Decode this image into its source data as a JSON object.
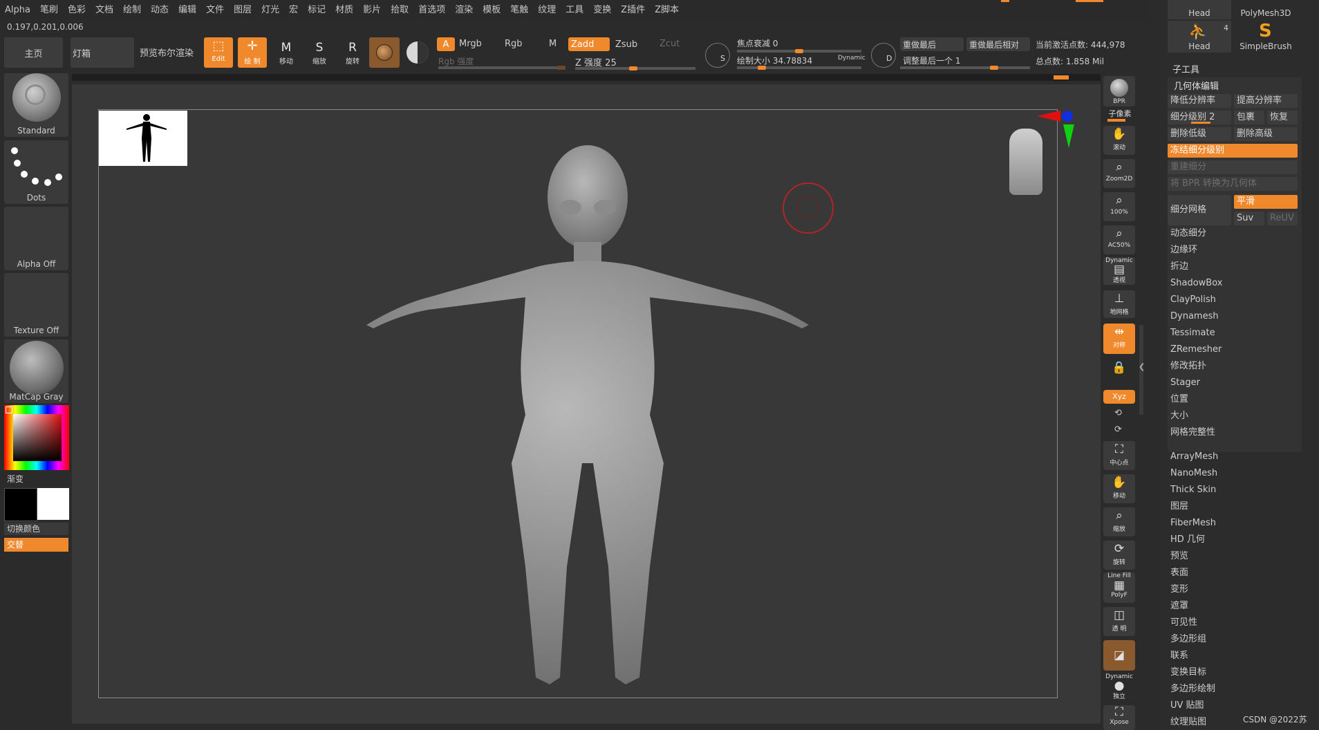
{
  "menu": [
    "Alpha",
    "笔刷",
    "色彩",
    "文档",
    "绘制",
    "动态",
    "编辑",
    "文件",
    "图层",
    "灯光",
    "宏",
    "标记",
    "材质",
    "影片",
    "拾取",
    "首选项",
    "渲染",
    "模板",
    "笔触",
    "纹理",
    "工具",
    "变换",
    "Z插件",
    "Z脚本"
  ],
  "coords": "0.197,0.201,0.006",
  "toolbar": {
    "home": "主页",
    "lightbox": "灯箱",
    "preview_bool": "预览布尔渲染",
    "edit": "Edit",
    "draw": "绘 制",
    "move": "移动",
    "scale": "缩放",
    "rotate": "旋转",
    "m_glyph": "M",
    "s_glyph": "S",
    "r_glyph": "R",
    "a": "A",
    "mrgb": "Mrgb",
    "rgb": "Rgb",
    "m": "M",
    "zadd": "Zadd",
    "zsub": "Zsub",
    "zcut": "Zcut",
    "rgb_intensity": "Rgb 强度",
    "z_intensity": "Z 强度 25",
    "focal_shift": "焦点衰减 0",
    "draw_size": "绘制大小 34.78834",
    "dynamic": "Dynamic",
    "s_label": "S",
    "d_label": "D",
    "redo_last": "重做最后",
    "redo_last_rel": "重做最后相对",
    "adjust_last": "调整最后一个 1",
    "active_points": "当前激活点数: 444,978",
    "total_points": "总点数: 1.858 Mil"
  },
  "left": {
    "brush": "Standard",
    "stroke": "Dots",
    "alpha": "Alpha Off",
    "texture": "Texture Off",
    "material": "MatCap Gray",
    "gradient": "渐变",
    "switch_color": "切换颜色",
    "alternate": "交替"
  },
  "rightTools": {
    "bpr": "BPR",
    "subpixel": "子像素",
    "scroll": "滚动",
    "zoom2d": "Zoom2D",
    "zoom100": "100%",
    "ac50": "AC50%",
    "persp_top": "Dynamic",
    "persp": "透视",
    "floor": "地网格",
    "sym": "对称",
    "lock": "",
    "xyz": "Xyz",
    "center": "中心点",
    "move": "移动",
    "scale": "缩放",
    "rotate": "旋转",
    "linefill_top": "Line Fill",
    "linefill": "PolyF",
    "transp": "透 明",
    "dyn2": "Dynamic",
    "solo": "独立",
    "xpose": "Xpose"
  },
  "rpanel": {
    "tool1": "Head",
    "tool2": "PolyMesh3D",
    "tool3": "Head",
    "tool3_count": "4",
    "tool4": "SimpleBrush",
    "subtool": "子工具",
    "geometry": "几何体编辑",
    "lower_res": "降低分辨率",
    "higher_res": "提高分辨率",
    "sdiv": "细分级别 2",
    "cage": "包裹",
    "restore": "恢复",
    "del_lower": "删除低级",
    "del_higher": "删除高级",
    "freeze": "冻结细分级别",
    "reconstruct": "重建细分",
    "bpr_to_geo": "将 BPR 转换为几何体",
    "divide": "细分网格",
    "smooth": "平滑",
    "suv": "Suv",
    "reuv": "ReUV",
    "items": [
      "动态细分",
      "边缘环",
      "折边",
      "ShadowBox",
      "ClayPolish",
      "Dynamesh",
      "Tessimate",
      "ZRemesher",
      "修改拓扑",
      "Stager",
      "位置",
      "大小",
      "网格完整性"
    ],
    "subs": [
      "ArrayMesh",
      "NanoMesh",
      "Thick Skin",
      "图层",
      "FiberMesh",
      "HD 几何",
      "预览",
      "表面",
      "变形",
      "遮罩",
      "可见性",
      "多边形组",
      "联系",
      "变换目标",
      "多边形绘制",
      "UV 贴图",
      "纹理贴图"
    ]
  },
  "watermark": "CSDN @2022苏"
}
